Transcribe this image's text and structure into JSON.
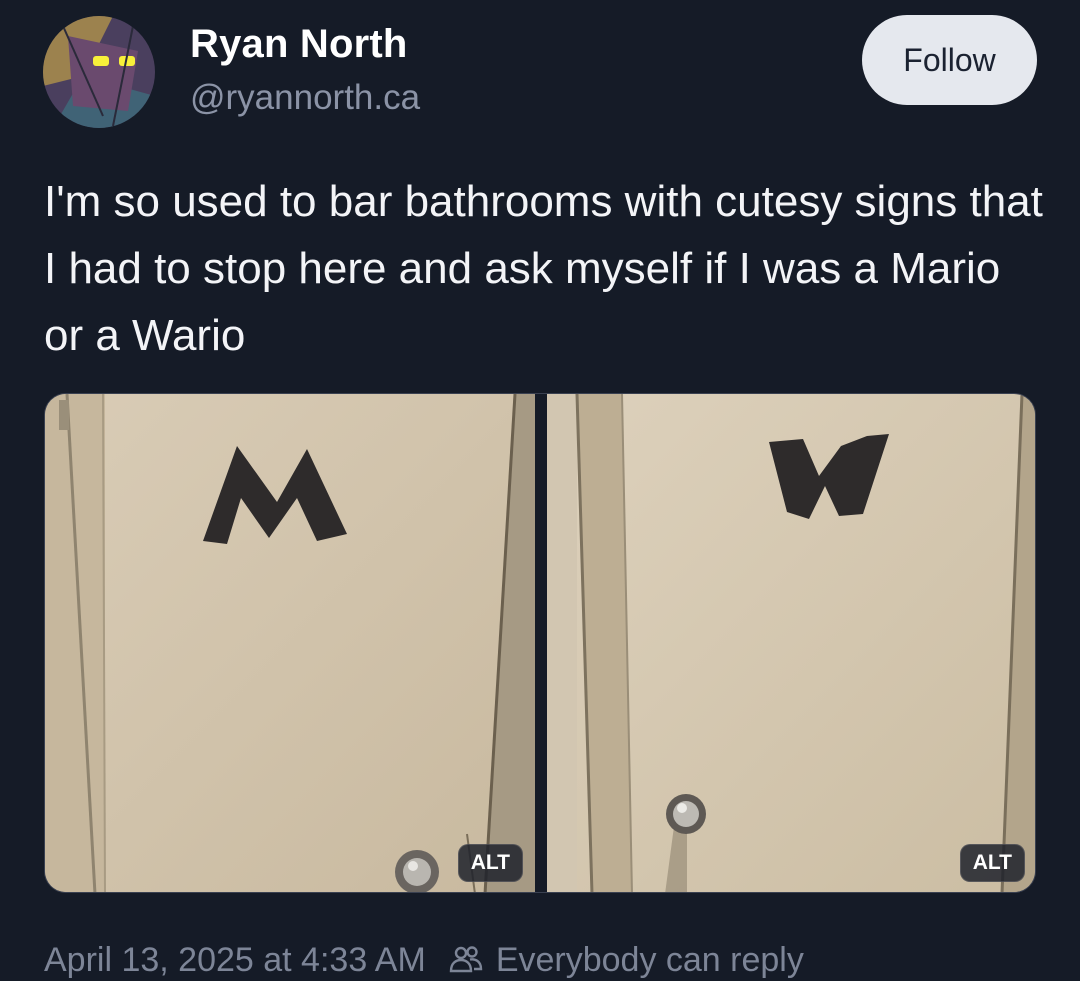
{
  "author": {
    "name": "Ryan North",
    "handle": "@ryannorth.ca"
  },
  "follow_label": "Follow",
  "post": {
    "text": "I'm so used to bar bathrooms with cutesy signs that I had to stop here and ask myself if I was a Mario or a Wario"
  },
  "images": [
    {
      "door_letter": "M",
      "alt_label": "ALT"
    },
    {
      "door_letter": "W",
      "alt_label": "ALT"
    }
  ],
  "footer": {
    "timestamp": "April 13, 2025 at 4:33 AM",
    "reply_setting": "Everybody can reply",
    "reply_icon": "people-icon"
  },
  "colors": {
    "background": "#151b27",
    "follow_button_bg": "#e5e8ee",
    "secondary_text": "#7d8597"
  }
}
